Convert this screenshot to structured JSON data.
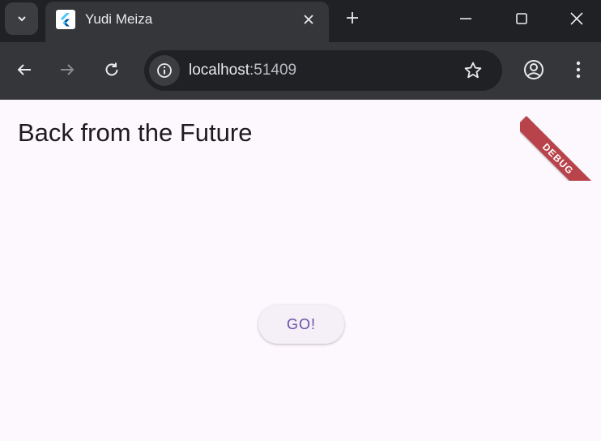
{
  "browser": {
    "tab": {
      "title": "Yudi Meiza",
      "favicon": "flutter-logo-icon"
    },
    "address": {
      "host": "localhost",
      "port": ":51409"
    },
    "icons": [
      "chevron-down-icon",
      "close-icon",
      "plus-icon",
      "minimize-icon",
      "maximize-icon",
      "window-close-icon",
      "back-arrow-icon",
      "forward-arrow-icon",
      "reload-icon",
      "info-icon",
      "star-icon",
      "profile-icon",
      "kebab-menu-icon"
    ],
    "colors": {
      "frame": "#202124",
      "toolbar": "#35363a",
      "page_bg": "#fdf7fe",
      "accent": "#6750a4",
      "debug_banner": "#b8434a"
    }
  },
  "page": {
    "title": "Back from the Future",
    "go_label": "GO!",
    "debug_label": "DEBUG"
  }
}
